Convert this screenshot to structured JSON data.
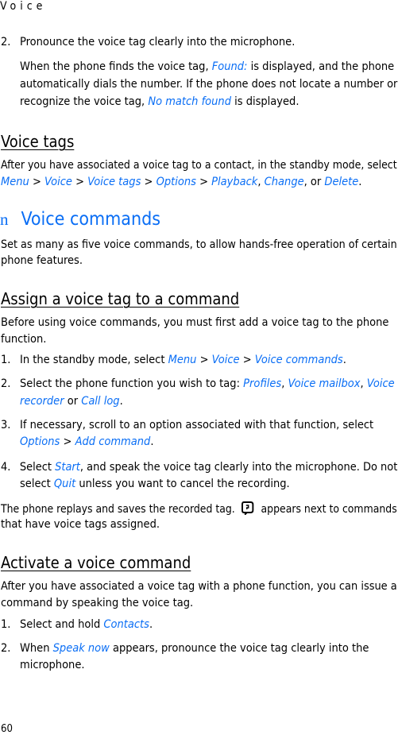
{
  "running_head": "Voice",
  "intro": {
    "step2_num": "2.",
    "step2_text": "Pronounce the voice tag clearly into the microphone.",
    "p_l1_a": "When the phone finds the voice tag, ",
    "p_l1_found": "Found:",
    "p_l1_b": " is displayed, and the phone",
    "p_l2": "automatically dials the number. If the phone does not locate a number or",
    "p_l3_a": "recognize the voice tag, ",
    "p_l3_nomatch": "No match found",
    "p_l3_b": " is displayed."
  },
  "voice_tags": {
    "heading": "Voice tags",
    "l1": "After you have associated a voice tag to a contact, in the standby mode, select",
    "path": [
      "Menu",
      "Voice",
      "Voice tags",
      "Options",
      "Playback",
      "Change",
      "Delete"
    ],
    "sep": " > ",
    "comma": ", ",
    "or": ", or ",
    "end": "."
  },
  "voice_commands": {
    "bullet": "n",
    "heading": "Voice commands",
    "l1": "Set as many as five voice commands, to allow hands-free operation of certain",
    "l2": "phone features."
  },
  "assign": {
    "heading": "Assign a voice tag to a command",
    "p_l1": "Before using voice commands, you must first add a voice tag to the phone",
    "p_l2": "function.",
    "s1_num": "1.",
    "s1_a": "In the standby mode, select ",
    "s1_menu": "Menu",
    "s1_voice": "Voice",
    "s1_vc": "Voice commands",
    "s2_num": "2.",
    "s2_a": "Select the phone function you wish to tag: ",
    "s2_profiles": "Profiles",
    "s2_mailbox": "Voice mailbox",
    "s2_voice": "Voice",
    "s2_recorder": "recorder",
    "s2_or": " or ",
    "s2_calllog": "Call log",
    "s3_num": "3.",
    "s3_a": "If necessary, scroll to an option associated with that function, select",
    "s3_options": "Options",
    "s3_add": "Add command",
    "s4_num": "4.",
    "s4_a": "Select ",
    "s4_start": "Start",
    "s4_b": ", and speak the voice tag clearly into the microphone. Do not",
    "s4_c": "select ",
    "s4_quit": "Quit",
    "s4_d": " unless you want to cancel the recording.",
    "after_l1_a": "The phone replays and saves the recorded tag.",
    "after_icon": "voice-tag-icon",
    "after_l1_b": "appears next to commands",
    "after_l2": "that have voice tags assigned."
  },
  "activate": {
    "heading": "Activate a voice command",
    "p_l1": "After you have associated a voice tag with a phone function, you can issue a",
    "p_l2": "command by speaking the voice tag.",
    "s1_num": "1.",
    "s1_a": "Select and hold ",
    "s1_contacts": "Contacts",
    "s2_num": "2.",
    "s2_a": "When ",
    "s2_speak": "Speak now",
    "s2_b": " appears, pronounce the voice tag clearly into the",
    "s2_c": "microphone."
  },
  "page_number": "60",
  "colors": {
    "link": "#0a6ef5",
    "text": "#000000"
  }
}
